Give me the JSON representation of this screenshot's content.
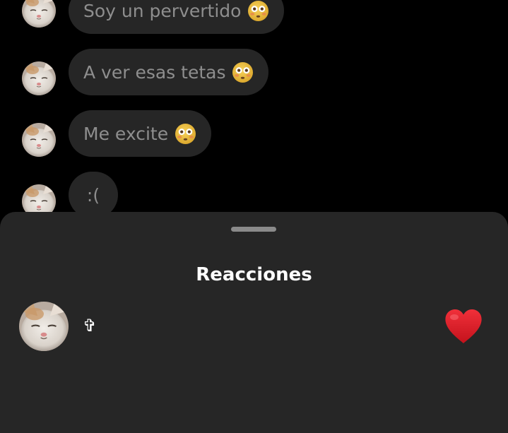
{
  "chat": {
    "messages": [
      {
        "text": "Soy un pervertido",
        "emoji": "flushed-face"
      },
      {
        "text": "A ver esas tetas",
        "emoji": "flushed-face"
      },
      {
        "text": "Me excite",
        "emoji": "flushed-face"
      },
      {
        "text": ":(",
        "emoji": ""
      }
    ]
  },
  "reactions_sheet": {
    "title": "Reacciones",
    "items": [
      {
        "username": "✞",
        "reaction": "red-heart",
        "reaction_color": "#e0202a"
      }
    ]
  },
  "colors": {
    "background": "#000000",
    "bubble": "#262626",
    "bubble_text": "#8e8e8e",
    "sheet": "#262626",
    "title": "#ffffff",
    "heart": "#e0202a"
  }
}
